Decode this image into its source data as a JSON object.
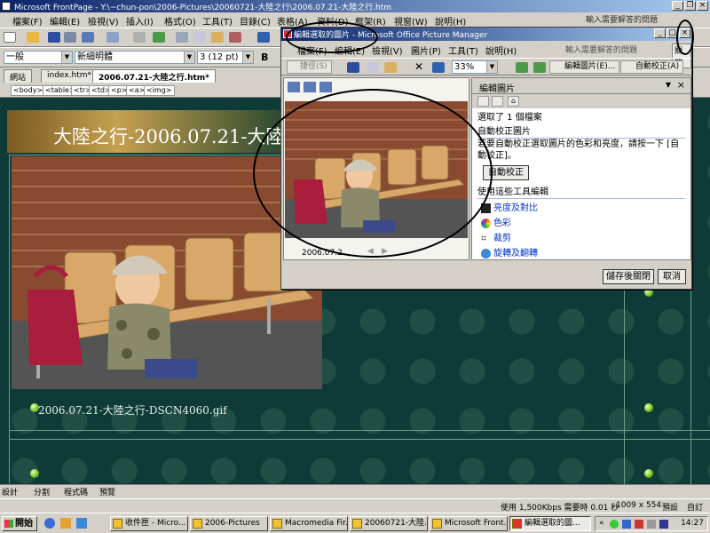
{
  "fp": {
    "title": "Microsoft FrontPage - Y:\\~chun-pon\\2006-Pictures\\20060721-大陸之行\\2006.07.21-大陸之行.htm",
    "menu": [
      "檔案(F)",
      "編輯(E)",
      "檢視(V)",
      "插入(I)",
      "格式(O)",
      "工具(T)",
      "目錄(C)",
      "表格(A)",
      "資料(D)",
      "框架(R)",
      "視窗(W)",
      "說明(H)"
    ],
    "help_placeholder": "輸入需要解答的問題",
    "style_value": "一般",
    "font_value": "新細明體",
    "size_value": "3  (12 pt)",
    "tabs": [
      "網站",
      "index.htm*",
      "2006.07.21-大陸之行.htm*"
    ],
    "close_label": "關閉",
    "tags": [
      "<body>",
      "<table>",
      "<tr>",
      "<td>",
      "<p>",
      "<a>",
      "<img>"
    ],
    "banner_title": "大陸之行-2006.07.21-大陸",
    "caption": "2006.07.21-大陸之行-DSCN4060.gif",
    "view_tabs": [
      "設計",
      "分割",
      "程式碼",
      "預覽"
    ],
    "status_speed": "使用 1,500Kbps 需要時 0.01 秒",
    "status_size": "1009 x 554",
    "status_default1": "預設",
    "status_default2": "自訂"
  },
  "pm": {
    "title": "編輯選取的圖片 - Microsoft Office Picture Manager",
    "menu": [
      "檔案(F)",
      "編輯(E)",
      "檢視(V)",
      "圖片(P)",
      "工具(T)",
      "說明(H)"
    ],
    "help_placeholder": "輸入需要解答的問題",
    "close_label": "關閉",
    "shortcut_label": "捷徑(S)",
    "zoom_value": "33%",
    "edit_button": "編輯圖片(E)...",
    "autofix_button": "自動校正(A)",
    "date_label": "2006.07.2...",
    "task_title": "編輯圖片",
    "selected_info": "選取了 1 個檔案",
    "autofix_head": "自動校正圖片",
    "autofix_desc": "若要自動校正選取圖片的色彩和亮度，請按一下 [自動校正]。",
    "autofix_btn": "自動校正",
    "tools_head": "使用這些工具編輯",
    "tools": [
      {
        "label": "亮度及對比",
        "icon": "brightness-icon"
      },
      {
        "label": "色彩",
        "icon": "color-icon"
      },
      {
        "label": "裁剪",
        "icon": "crop-icon"
      },
      {
        "label": "旋轉及翻轉",
        "icon": "rotate-icon"
      }
    ],
    "save_close": "儲存後關閉",
    "cancel": "取消"
  },
  "taskbar": {
    "start": "開始",
    "tasks": [
      "收件匣 - Micro...",
      "2006-Pictures",
      "Macromedia Fir...",
      "20060721-大陸...",
      "Microsoft Front...",
      "編輯選取的圖..."
    ],
    "clock": "14:27"
  }
}
